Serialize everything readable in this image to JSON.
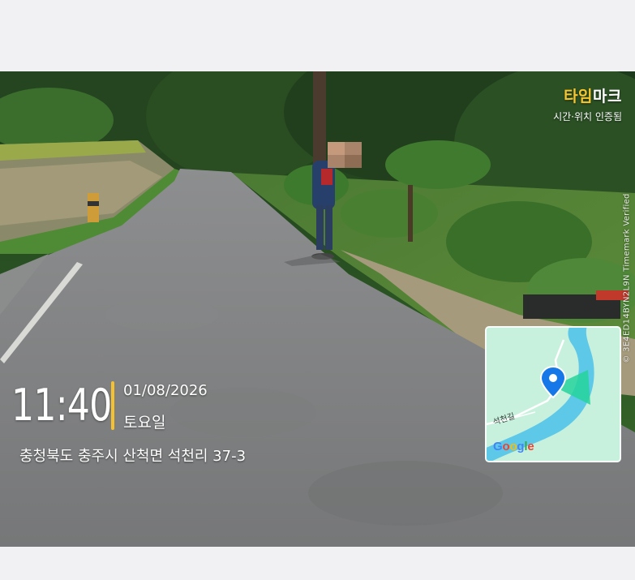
{
  "brand": {
    "name_accent": "타임",
    "name_rest": "마크",
    "subtitle": "시간·위치 인증됨"
  },
  "verification": {
    "text": "© 3E4ED14BYN2L9N   Timemark Verified"
  },
  "stamp": {
    "time": "11:40",
    "date": "01/08/2026",
    "weekday": "토요일",
    "address": "충청북도 충주시 산척면 석천리 37-3"
  },
  "map": {
    "road_label": "석천길",
    "logo_letters": [
      "G",
      "o",
      "o",
      "g",
      "l",
      "e"
    ],
    "logo_colors": [
      "#4285F4",
      "#EA4335",
      "#FBBC05",
      "#4285F4",
      "#34A853",
      "#EA4335"
    ],
    "pin_icon": "location-pin-icon"
  },
  "colors": {
    "accent_yellow": "#f5c22d",
    "page_bg": "#f1f1f3",
    "map_bg": "#c8f1dd",
    "map_water": "#5ec8e8"
  }
}
